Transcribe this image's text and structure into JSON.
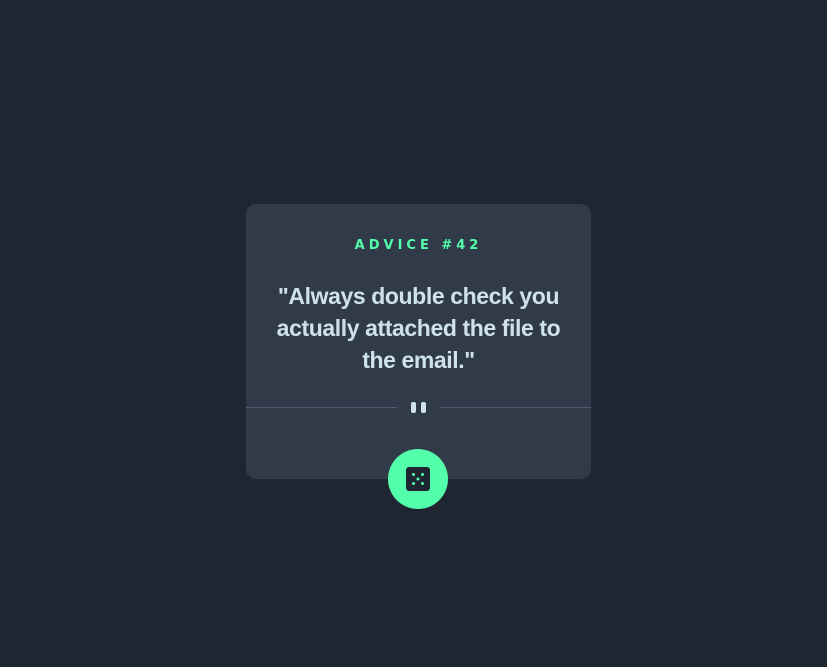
{
  "advice": {
    "label": "ADVICE #42",
    "text": "\"Always double check you actually attached the file to the email.\""
  },
  "icons": {
    "divider": "pause-icon",
    "button": "dice-icon"
  },
  "colors": {
    "background": "#202631",
    "card": "#313a48",
    "accent": "#53ffab",
    "text": "#cee3e9",
    "divider": "#4f5d74"
  }
}
